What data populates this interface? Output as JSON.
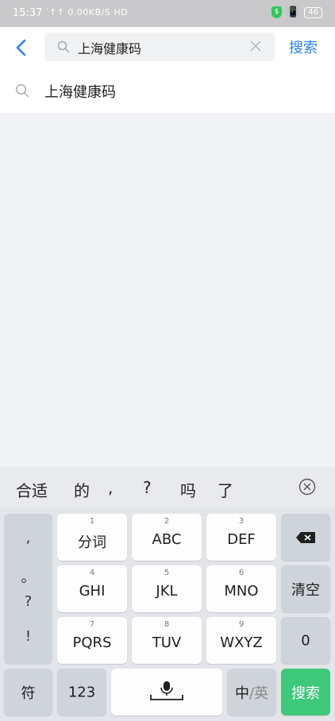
{
  "status_bar": {
    "time": "15:37",
    "network": "´↑↑ 0.00KB/S HD",
    "battery": "46"
  },
  "header": {
    "search_value": "上海健康码",
    "search_button": "搜索"
  },
  "suggestions": [
    {
      "text": "上海健康码"
    }
  ],
  "candidates": [
    "合适",
    "的",
    ",",
    "?",
    "吗",
    "了"
  ],
  "keyboard": {
    "punct": [
      ",",
      "。",
      "?",
      "!"
    ],
    "keys": [
      {
        "num": "1",
        "label": "分词"
      },
      {
        "num": "2",
        "label": "ABC"
      },
      {
        "num": "3",
        "label": "DEF"
      },
      {
        "num": "4",
        "label": "GHI"
      },
      {
        "num": "5",
        "label": "JKL"
      },
      {
        "num": "6",
        "label": "MNO"
      },
      {
        "num": "7",
        "label": "PQRS"
      },
      {
        "num": "8",
        "label": "TUV"
      },
      {
        "num": "9",
        "label": "WXYZ"
      }
    ],
    "clear": "清空",
    "zero": "0",
    "symbol": "符",
    "numeric": "123",
    "lang_zh": "中",
    "lang_sep": "/",
    "lang_en": "英",
    "search": "搜索"
  },
  "colors": {
    "accent_blue": "#2a7ff7",
    "search_key_green": "#3dc87a"
  }
}
